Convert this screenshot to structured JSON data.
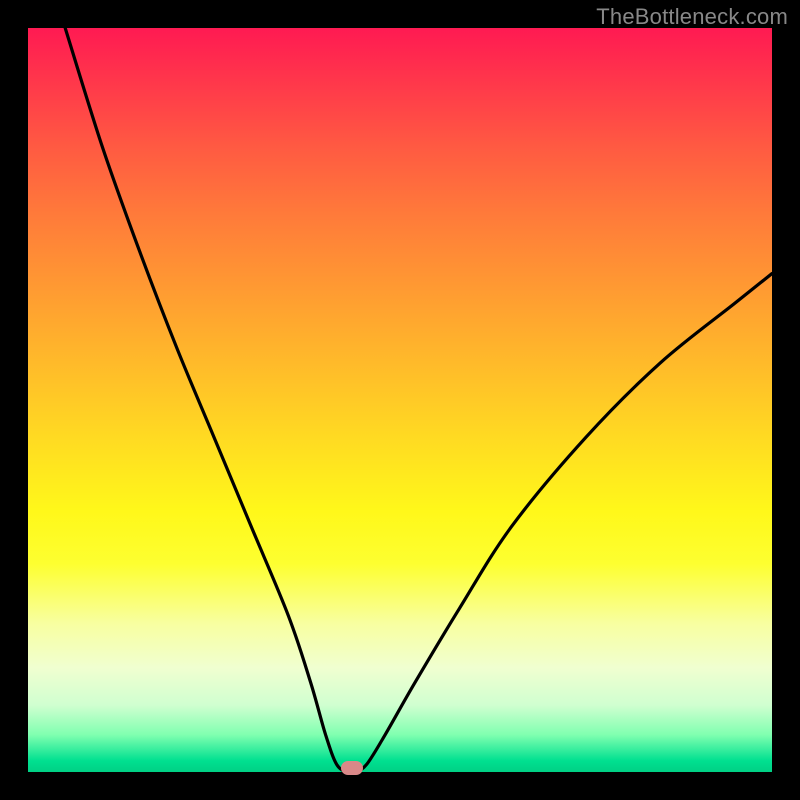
{
  "watermark": "TheBottleneck.com",
  "chart_data": {
    "type": "line",
    "title": "",
    "xlabel": "",
    "ylabel": "",
    "xlim": [
      0,
      100
    ],
    "ylim": [
      0,
      100
    ],
    "grid": false,
    "series": [
      {
        "name": "bottleneck-curve",
        "x": [
          5,
          10,
          15,
          20,
          25,
          30,
          35,
          38,
          40,
          41.5,
          43,
          44,
          45.5,
          48,
          52,
          58,
          65,
          75,
          85,
          95,
          100
        ],
        "values": [
          100,
          84,
          70,
          57,
          45,
          33,
          21,
          12,
          5,
          1,
          0,
          0,
          1,
          5,
          12,
          22,
          33,
          45,
          55,
          63,
          67
        ]
      }
    ],
    "marker": {
      "x": 43.5,
      "y": 0.5,
      "color": "#d98888"
    },
    "background_gradient": {
      "type": "vertical",
      "stops": [
        {
          "pos": 0,
          "color": "#ff1a52"
        },
        {
          "pos": 25,
          "color": "#ff7a3a"
        },
        {
          "pos": 55,
          "color": "#ffda22"
        },
        {
          "pos": 80,
          "color": "#f8ffa0"
        },
        {
          "pos": 95,
          "color": "#80ffb0"
        },
        {
          "pos": 100,
          "color": "#00d085"
        }
      ]
    }
  }
}
